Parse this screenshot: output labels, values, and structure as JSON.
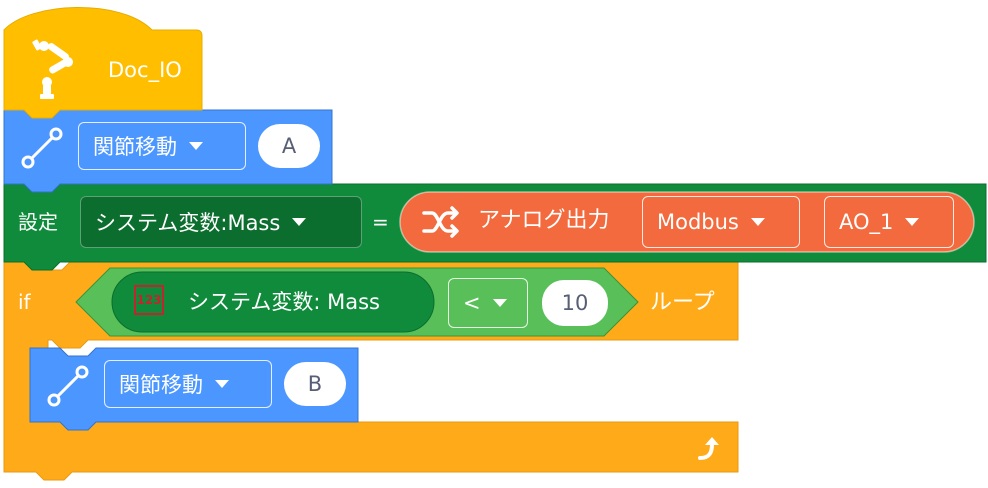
{
  "colors": {
    "hat": "#FFBF00",
    "motion": "#4C97FF",
    "motion_dark": "#3373CC",
    "set": "#0F8B3B",
    "set_dark": "#0B6E2E",
    "analog": "#F26A3D",
    "control": "#FFAB19",
    "control_dark": "#E79A13",
    "compare": "#59C059",
    "compare_dark": "#389438",
    "badge_red": "#C0262D"
  },
  "hat": {
    "title": "Doc_IO",
    "icon": "robot-arm-icon"
  },
  "move1": {
    "icon": "line-path-icon",
    "dropdown": "関節移動",
    "target": "A"
  },
  "set_block": {
    "label": "設定",
    "variable": "システム変数:Mass",
    "equals": "=",
    "reporter": {
      "icon": "shuffle-icon",
      "label": "アナログ出力",
      "protocol": "Modbus",
      "port": "AO_1"
    }
  },
  "loop": {
    "if_label": "if",
    "variable_badge": "123",
    "variable_label": "システム変数: Mass",
    "operator": "<",
    "value": "10",
    "loop_label": "ループ",
    "loop_icon": "loop-arrow-icon"
  },
  "move2": {
    "icon": "line-path-icon",
    "dropdown": "関節移動",
    "target": "B"
  }
}
